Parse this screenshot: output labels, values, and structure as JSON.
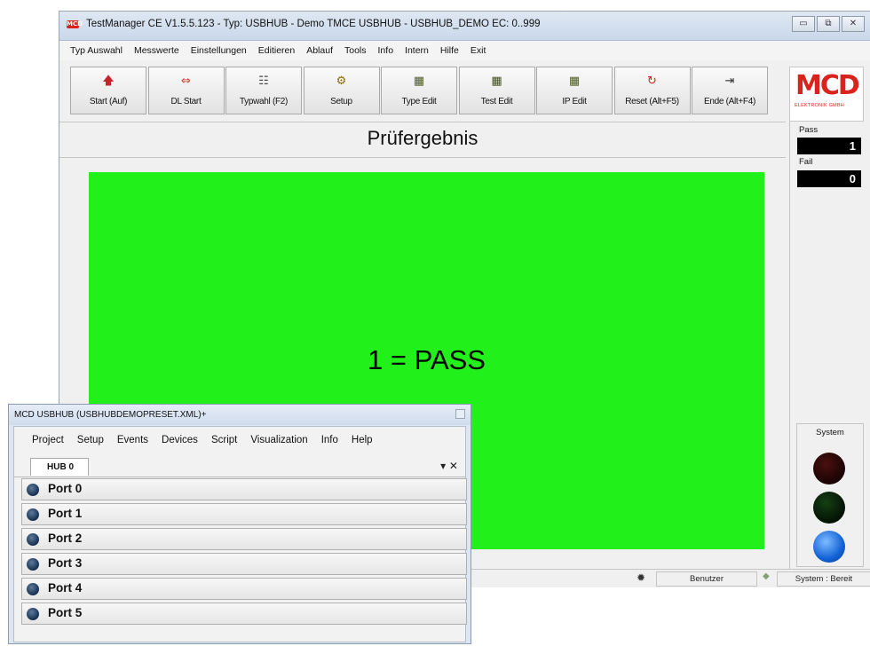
{
  "main_window": {
    "title": "TestManager CE  V1.5.5.123 - Typ: USBHUB - Demo TMCE USBHUB - USBHUB_DEMO EC: 0..999",
    "icon_text": "MCD",
    "controls": {
      "minimize": "▭",
      "maximize": "⧉",
      "close": "✕"
    },
    "menu": [
      "Typ Auswahl",
      "Messwerte",
      "Einstellungen",
      "Editieren",
      "Ablauf",
      "Tools",
      "Info",
      "Intern",
      "Hilfe",
      "Exit"
    ],
    "toolbar": [
      {
        "label": "Start (Auf)",
        "icon": "up-arrow-icon",
        "glyph": "🡅",
        "color": "#c0262a"
      },
      {
        "label": "DL Start",
        "icon": "dl-start-icon",
        "glyph": "⇔",
        "color": "#d13c2c"
      },
      {
        "label": "Typwahl (F2)",
        "icon": "list-tree-icon",
        "glyph": "☷",
        "color": "#4a4a4a"
      },
      {
        "label": "Setup",
        "icon": "setup-icon",
        "glyph": "⚙",
        "color": "#8a6b10"
      },
      {
        "label": "Type Edit",
        "icon": "type-edit-icon",
        "glyph": "▦",
        "color": "#4c5b2a"
      },
      {
        "label": "Test Edit",
        "icon": "test-edit-icon",
        "glyph": "▦",
        "color": "#3c4c1a"
      },
      {
        "label": "IP Edit",
        "icon": "ip-edit-icon",
        "glyph": "▦",
        "color": "#4c5b2a"
      },
      {
        "label": "Reset (Alt+F5)",
        "icon": "reset-icon",
        "glyph": "↻",
        "color": "#c8231d"
      },
      {
        "label": "Ende (Alt+F4)",
        "icon": "exit-icon",
        "glyph": "⇥",
        "color": "#333333"
      }
    ],
    "logo": {
      "text": "MCD",
      "subtext": "ELEKTRONIK GMBH"
    },
    "result_title": "Prüfergebnis",
    "result_text": "1 = PASS",
    "result_color": "#22f01b",
    "counters": [
      {
        "label": "Pass",
        "value": "1"
      },
      {
        "label": "Fail",
        "value": "0"
      }
    ],
    "system": {
      "label": "System"
    },
    "status": {
      "user": "Benutzer",
      "system": "System : Bereit"
    }
  },
  "hub_window": {
    "title": "MCD USBHUB (USBHUBDEMOPRESET.XML)+",
    "menu": [
      "Project",
      "Setup",
      "Events",
      "Devices",
      "Script",
      "Visualization",
      "Info",
      "Help"
    ],
    "tab": "HUB 0",
    "tab_controls": "▾ ✕",
    "ports": [
      "Port 0",
      "Port 1",
      "Port 2",
      "Port 3",
      "Port 4",
      "Port 5"
    ]
  }
}
